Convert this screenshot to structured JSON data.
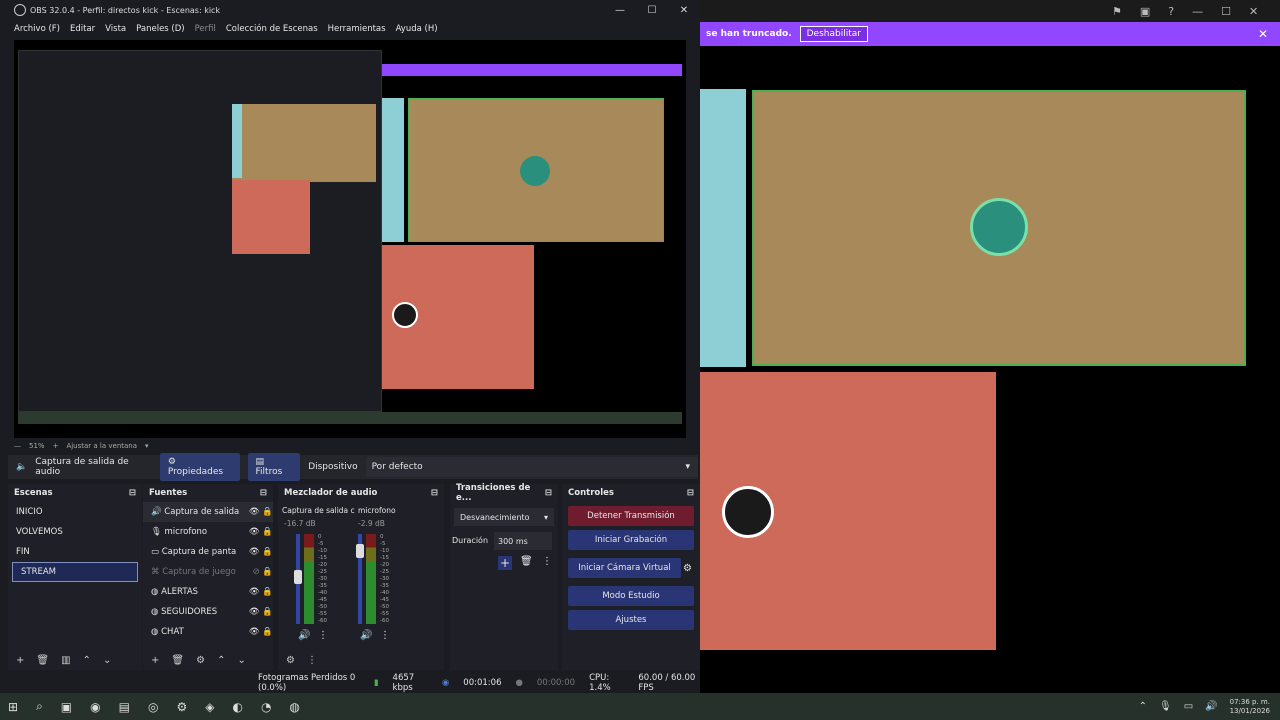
{
  "background": {
    "purple_banner": {
      "message": "se han truncado.",
      "button": "Deshabilitar"
    },
    "colors": {
      "blue": "#8ecfd6",
      "tan": "#a8895a",
      "red": "#cd6a5a",
      "purple": "#9147ff"
    }
  },
  "window": {
    "title": "OBS 32.0.4 - Perfil: directos kick - Escenas: kick",
    "menu": [
      "Archivo (F)",
      "Editar",
      "Vista",
      "Paneles (D)",
      "Perfil",
      "Colección de Escenas",
      "Herramientas",
      "Ayuda (H)"
    ]
  },
  "zoom": {
    "value": "51%",
    "fit": "Ajustar a la ventana"
  },
  "source_bar": {
    "source": "Captura de salida de audio",
    "props": "Propiedades",
    "filters": "Filtros",
    "device_label": "Dispositivo",
    "device_value": "Por defecto"
  },
  "scenes": {
    "title": "Escenas",
    "items": [
      "INICIO",
      "VOLVEMOS",
      "FIN",
      "STREAM"
    ]
  },
  "sources": {
    "title": "Fuentes",
    "items": [
      "Captura de salida",
      "microfono",
      "Captura de panta",
      "Captura de juego",
      "ALERTAS",
      "SEGUIDORES",
      "CHAT"
    ]
  },
  "mixer": {
    "title": "Mezclador de audio",
    "ch1": {
      "name": "Captura de salida c",
      "db": "-16.7 dB"
    },
    "ch2": {
      "name": "microfono",
      "db": "-2.9 dB"
    },
    "scale": [
      "0",
      "-5",
      "-10",
      "-15",
      "-20",
      "-25",
      "-30",
      "-35",
      "-40",
      "-45",
      "-50",
      "-55",
      "-60"
    ]
  },
  "transitions": {
    "title": "Transiciones de e...",
    "type": "Desvanecimiento",
    "duration_label": "Duración",
    "duration_value": "300 ms"
  },
  "controls": {
    "title": "Controles",
    "stop_stream": "Detener Transmisión",
    "start_rec": "Iniciar Grabación",
    "start_vcam": "Iniciar Cámara Virtual",
    "studio": "Modo Estudio",
    "settings": "Ajustes"
  },
  "status": {
    "dropped": "Fotogramas Perdidos 0 (0.0%)",
    "bitrate": "4657 kbps",
    "stream_time": "00:01:06",
    "rec_time": "00:00:00",
    "cpu": "CPU: 1.4%",
    "fps": "60.00 / 60.00 FPS"
  },
  "taskbar": {
    "time": "07:36 p. m.",
    "date": "13/01/2026"
  }
}
